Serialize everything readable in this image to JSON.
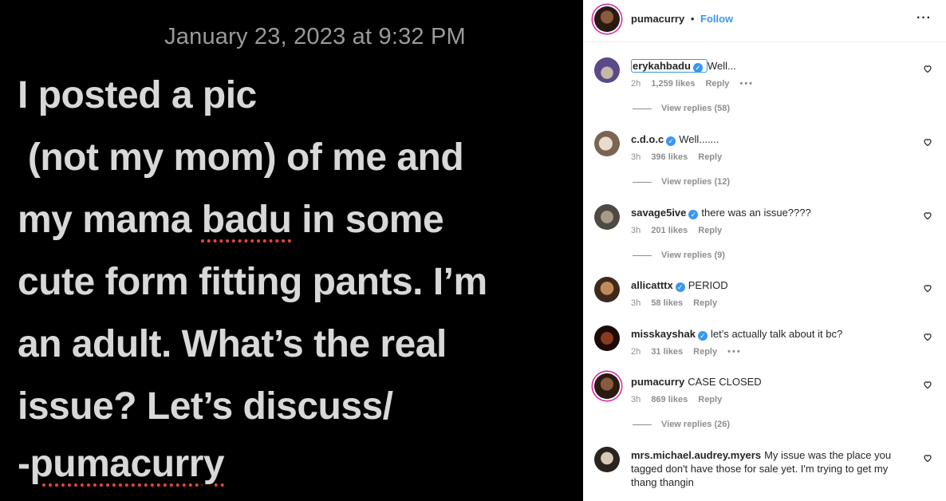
{
  "note": {
    "date": "January 23, 2023 at 9:32 PM",
    "lines": [
      {
        "before": "I posted a pic",
        "flag": "",
        "after": ""
      },
      {
        "before": " (not my mom) of me and",
        "flag": "",
        "after": ""
      },
      {
        "before": "my mama ",
        "flag": "badu",
        "after": " in some"
      },
      {
        "before": "cute form fitting pants. I’m",
        "flag": "",
        "after": ""
      },
      {
        "before": "an adult. What’s the real",
        "flag": "",
        "after": ""
      },
      {
        "before": "issue? Let’s discuss/",
        "flag": "",
        "after": ""
      },
      {
        "before": "-",
        "flag": "pumacurry",
        "after": ""
      }
    ]
  },
  "header": {
    "username": "pumacurry",
    "separator": "•",
    "follow_label": "Follow",
    "more_icon": "ellipsis-icon"
  },
  "colors": {
    "accent": "#3897f0",
    "text": "#262626",
    "muted": "#8e8e8e",
    "story_ring": "#d6249f",
    "spellcheck": "#e8453c"
  },
  "comments": [
    {
      "username": "erykahbadu",
      "verified": true,
      "text": "Well...",
      "time": "2h",
      "likes": "1,259 likes",
      "reply": "Reply",
      "more": "•••",
      "view_replies": "View replies (58)",
      "highlight": true
    },
    {
      "username": "c.d.o.c",
      "verified": true,
      "text": "Well.......",
      "time": "3h",
      "likes": "396 likes",
      "reply": "Reply",
      "more": "",
      "view_replies": "View replies (12)"
    },
    {
      "username": "savage5ive",
      "verified": true,
      "text": "there was an issue????",
      "time": "3h",
      "likes": "201 likes",
      "reply": "Reply",
      "more": "",
      "view_replies": "View replies (9)"
    },
    {
      "username": "allicatttx",
      "verified": true,
      "text": "PERIOD",
      "time": "3h",
      "likes": "58 likes",
      "reply": "Reply",
      "more": "",
      "view_replies": ""
    },
    {
      "username": "misskayshak",
      "verified": true,
      "text": "let’s actually talk about it bc?",
      "time": "2h",
      "likes": "31 likes",
      "reply": "Reply",
      "more": "•••",
      "view_replies": ""
    },
    {
      "username": "pumacurry",
      "verified": false,
      "text": "CASE CLOSED",
      "time": "3h",
      "likes": "869 likes",
      "reply": "Reply",
      "more": "",
      "view_replies": "View replies (26)"
    },
    {
      "username": "mrs.michael.audrey.myers",
      "verified": false,
      "text": "My issue was the place you tagged don't have those for sale yet. I'm trying to get my thang thangin",
      "time": "",
      "likes": "",
      "reply": "",
      "more": "",
      "view_replies": ""
    }
  ]
}
